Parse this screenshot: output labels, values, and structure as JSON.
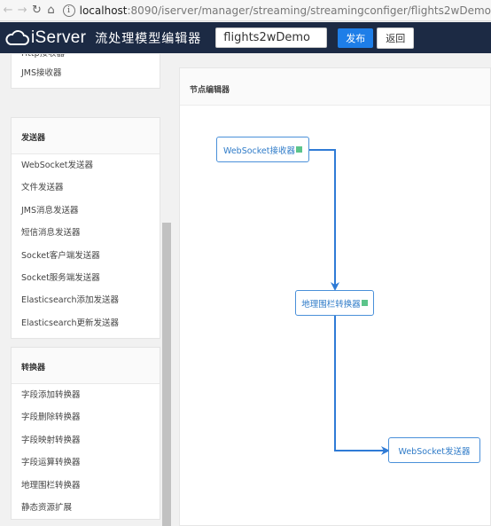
{
  "browser": {
    "url_host": "localhost",
    "url_path": ":8090/iserver/manager/streaming/streamingconfiger/flights2wDemo",
    "info_glyph": "i"
  },
  "header": {
    "logo_text": "iServer",
    "app_title": "流处理模型编辑器",
    "model_name_value": "flights2wDemo",
    "publish_label": "发布",
    "back_label": "返回"
  },
  "sidebar": {
    "receivers_tail": [
      {
        "label": "Http接收器"
      },
      {
        "label": "JMS接收器"
      }
    ],
    "senders": {
      "title": "发送器",
      "items": [
        {
          "label": "WebSocket发送器"
        },
        {
          "label": "文件发送器"
        },
        {
          "label": "JMS消息发送器"
        },
        {
          "label": "短信消息发送器"
        },
        {
          "label": "Socket客户端发送器"
        },
        {
          "label": "Socket服务端发送器"
        },
        {
          "label": "Elasticsearch添加发送器"
        },
        {
          "label": "Elasticsearch更新发送器"
        }
      ]
    },
    "converters": {
      "title": "转换器",
      "items": [
        {
          "label": "字段添加转换器"
        },
        {
          "label": "字段删除转换器"
        },
        {
          "label": "字段映射转换器"
        },
        {
          "label": "字段运算转换器"
        },
        {
          "label": "地理围栏转换器"
        },
        {
          "label": "静态资源扩展"
        }
      ]
    }
  },
  "editor": {
    "title": "节点编辑器",
    "nodes": [
      {
        "label": "WebSocket接收器"
      },
      {
        "label": "地理围栏转换器"
      },
      {
        "label": "WebSocket发送器"
      }
    ]
  },
  "colors": {
    "header_bg": "#1c2a44",
    "accent": "#1e7ee8",
    "node_border": "#4a90d9",
    "handle": "#5cc48a"
  }
}
